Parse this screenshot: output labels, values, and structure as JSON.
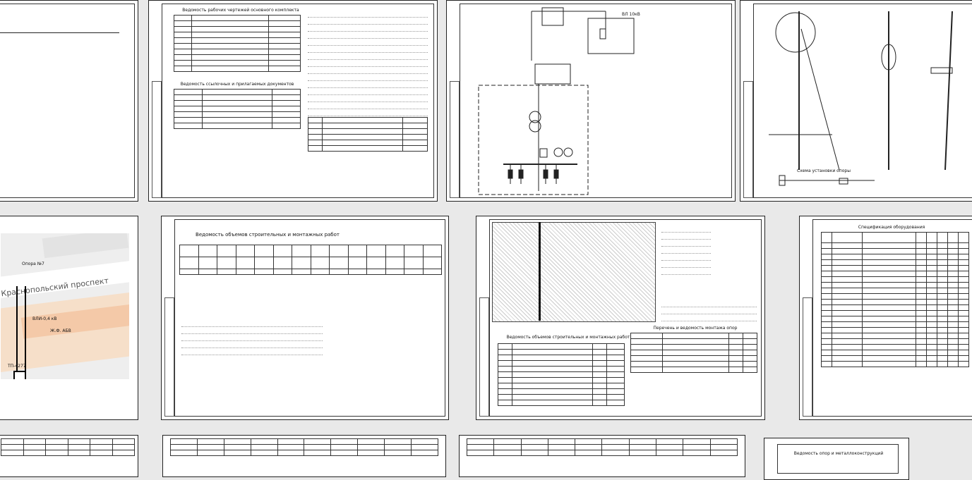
{
  "map": {
    "street": "Краснопольский проспект",
    "labels": [
      "Опора №7",
      "ВЛИ-0,4 кВ",
      "ТП-4277",
      "Ж.Ф. АБВ"
    ]
  },
  "sheets": {
    "s1_title1": "Ведомость рабочих чертежей основного комплекта",
    "s1_title2": "Ведомость ссылочных и прилагаемых документов",
    "s2_label": "ВЛ 10кВ",
    "s3_caption": "Схема установки опоры",
    "s4_title": "Ведомость объемов строительных и монтажных работ",
    "s5_title": "Спецификация оборудования",
    "s6_title": "Ведомость объемов строительных и монтажных работ",
    "s7_title": "Перечень и ведомость монтажа опор",
    "bottom_title": "Ведомость опор и металлоконструкций"
  },
  "colors": {
    "background": "#e9e9e9",
    "sheet": "#ffffff",
    "ink": "#222222",
    "map_road": "#ffffff",
    "map_block": "#f6dfc9"
  }
}
